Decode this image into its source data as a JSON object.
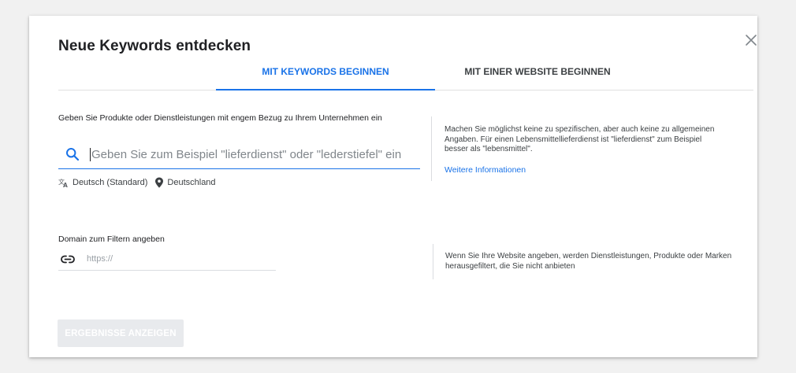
{
  "dialog": {
    "title": "Neue Keywords entdecken",
    "close_icon": "close-icon"
  },
  "tabs": [
    {
      "label": "MIT KEYWORDS BEGINNEN",
      "active": true
    },
    {
      "label": "MIT EINER WEBSITE BEGINNEN",
      "active": false
    }
  ],
  "keywords_section": {
    "label": "Geben Sie Produkte oder Dienstleistungen mit engem Bezug zu Ihrem Unternehmen ein",
    "search_icon": "search-icon",
    "input_value": "",
    "placeholder": "Geben Sie zum Beispiel \"lieferdienst\" oder \"lederstiefel\" ein",
    "language": "Deutsch (Standard)",
    "language_icon": "translate-icon",
    "location": "Deutschland",
    "location_icon": "location-pin-icon",
    "hint": "Machen Sie möglichst keine zu spezifischen, aber auch keine zu allgemeinen Angaben. Für einen Lebensmittellieferdienst ist \"lieferdienst\" zum Beispiel besser als \"lebensmittel\".",
    "more_link": "Weitere Informationen"
  },
  "domain_section": {
    "label": "Domain zum Filtern angeben",
    "link_icon": "link-icon",
    "input_value": "",
    "placeholder": "https://",
    "hint": "Wenn Sie Ihre Website angeben, werden Dienstleistungen, Produkte oder Marken herausgefiltert, die Sie nicht anbieten"
  },
  "actions": {
    "submit_label": "ERGEBNISSE ANZEIGEN",
    "submit_enabled": false
  },
  "colors": {
    "accent": "#1a73e8",
    "disabled_button_bg": "#e8eaed",
    "text": "#202124",
    "secondary_text": "#3c4043"
  }
}
